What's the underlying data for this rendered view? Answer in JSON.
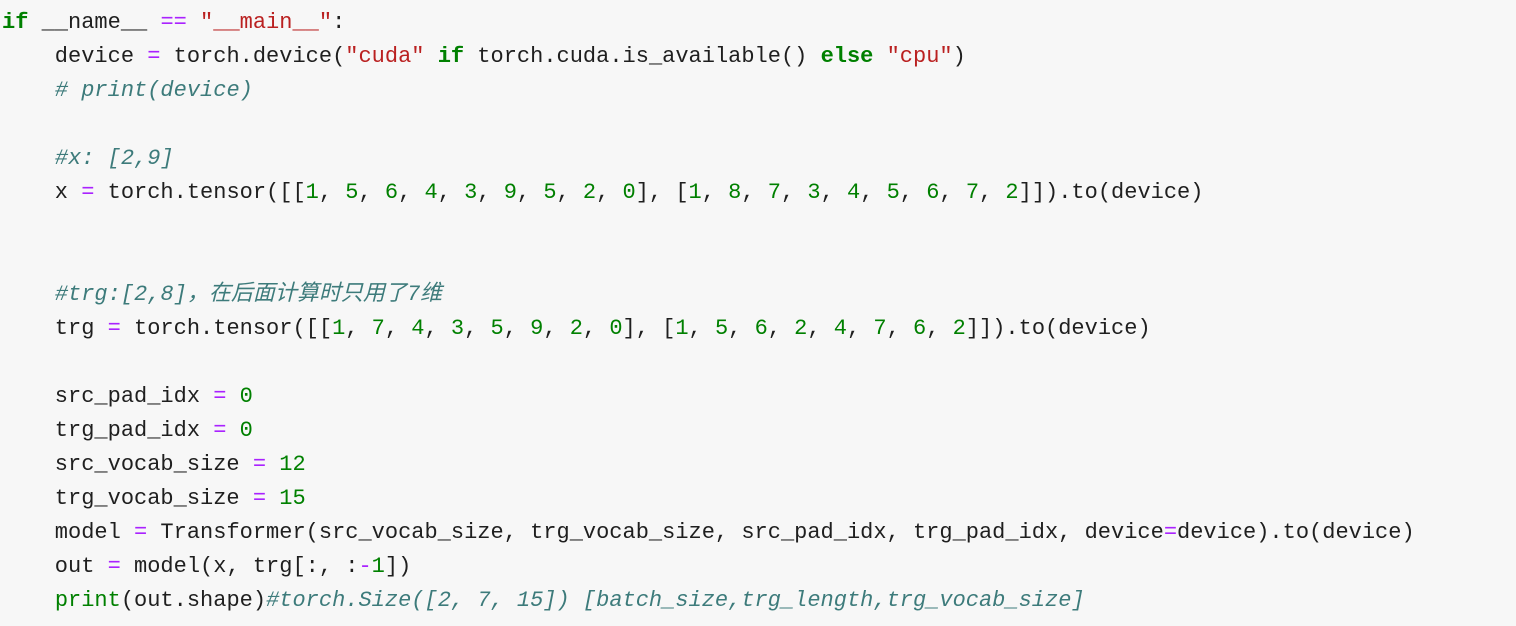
{
  "editor": {
    "lines": [
      [
        {
          "t": "if",
          "c": "kw"
        },
        {
          "t": " __name__ ",
          "c": "plain"
        },
        {
          "t": "==",
          "c": "op"
        },
        {
          "t": " ",
          "c": "plain"
        },
        {
          "t": "\"__main__\"",
          "c": "str"
        },
        {
          "t": ":",
          "c": "plain"
        }
      ],
      [
        {
          "t": "    device ",
          "c": "plain"
        },
        {
          "t": "=",
          "c": "op"
        },
        {
          "t": " torch.device(",
          "c": "plain"
        },
        {
          "t": "\"cuda\"",
          "c": "str"
        },
        {
          "t": " ",
          "c": "plain"
        },
        {
          "t": "if",
          "c": "kw"
        },
        {
          "t": " torch.cuda.is_available() ",
          "c": "plain"
        },
        {
          "t": "else",
          "c": "kw"
        },
        {
          "t": " ",
          "c": "plain"
        },
        {
          "t": "\"cpu\"",
          "c": "str"
        },
        {
          "t": ")",
          "c": "plain"
        }
      ],
      [
        {
          "t": "    ",
          "c": "plain"
        },
        {
          "t": "# print(device)",
          "c": "com"
        }
      ],
      [],
      [
        {
          "t": "    ",
          "c": "plain"
        },
        {
          "t": "#x: [2,9]",
          "c": "com"
        }
      ],
      [
        {
          "t": "    x ",
          "c": "plain"
        },
        {
          "t": "=",
          "c": "op"
        },
        {
          "t": " torch.tensor([[",
          "c": "plain"
        },
        {
          "t": "1",
          "c": "num"
        },
        {
          "t": ", ",
          "c": "plain"
        },
        {
          "t": "5",
          "c": "num"
        },
        {
          "t": ", ",
          "c": "plain"
        },
        {
          "t": "6",
          "c": "num"
        },
        {
          "t": ", ",
          "c": "plain"
        },
        {
          "t": "4",
          "c": "num"
        },
        {
          "t": ", ",
          "c": "plain"
        },
        {
          "t": "3",
          "c": "num"
        },
        {
          "t": ", ",
          "c": "plain"
        },
        {
          "t": "9",
          "c": "num"
        },
        {
          "t": ", ",
          "c": "plain"
        },
        {
          "t": "5",
          "c": "num"
        },
        {
          "t": ", ",
          "c": "plain"
        },
        {
          "t": "2",
          "c": "num"
        },
        {
          "t": ", ",
          "c": "plain"
        },
        {
          "t": "0",
          "c": "num"
        },
        {
          "t": "], [",
          "c": "plain"
        },
        {
          "t": "1",
          "c": "num"
        },
        {
          "t": ", ",
          "c": "plain"
        },
        {
          "t": "8",
          "c": "num"
        },
        {
          "t": ", ",
          "c": "plain"
        },
        {
          "t": "7",
          "c": "num"
        },
        {
          "t": ", ",
          "c": "plain"
        },
        {
          "t": "3",
          "c": "num"
        },
        {
          "t": ", ",
          "c": "plain"
        },
        {
          "t": "4",
          "c": "num"
        },
        {
          "t": ", ",
          "c": "plain"
        },
        {
          "t": "5",
          "c": "num"
        },
        {
          "t": ", ",
          "c": "plain"
        },
        {
          "t": "6",
          "c": "num"
        },
        {
          "t": ", ",
          "c": "plain"
        },
        {
          "t": "7",
          "c": "num"
        },
        {
          "t": ", ",
          "c": "plain"
        },
        {
          "t": "2",
          "c": "num"
        },
        {
          "t": "]]).to(device)",
          "c": "plain"
        }
      ],
      [],
      [],
      [
        {
          "t": "    ",
          "c": "plain"
        },
        {
          "t": "#trg:[2,8]，在后面计算时只用了7维",
          "c": "com"
        }
      ],
      [
        {
          "t": "    trg ",
          "c": "plain"
        },
        {
          "t": "=",
          "c": "op"
        },
        {
          "t": " torch.tensor([[",
          "c": "plain"
        },
        {
          "t": "1",
          "c": "num"
        },
        {
          "t": ", ",
          "c": "plain"
        },
        {
          "t": "7",
          "c": "num"
        },
        {
          "t": ", ",
          "c": "plain"
        },
        {
          "t": "4",
          "c": "num"
        },
        {
          "t": ", ",
          "c": "plain"
        },
        {
          "t": "3",
          "c": "num"
        },
        {
          "t": ", ",
          "c": "plain"
        },
        {
          "t": "5",
          "c": "num"
        },
        {
          "t": ", ",
          "c": "plain"
        },
        {
          "t": "9",
          "c": "num"
        },
        {
          "t": ", ",
          "c": "plain"
        },
        {
          "t": "2",
          "c": "num"
        },
        {
          "t": ", ",
          "c": "plain"
        },
        {
          "t": "0",
          "c": "num"
        },
        {
          "t": "], [",
          "c": "plain"
        },
        {
          "t": "1",
          "c": "num"
        },
        {
          "t": ", ",
          "c": "plain"
        },
        {
          "t": "5",
          "c": "num"
        },
        {
          "t": ", ",
          "c": "plain"
        },
        {
          "t": "6",
          "c": "num"
        },
        {
          "t": ", ",
          "c": "plain"
        },
        {
          "t": "2",
          "c": "num"
        },
        {
          "t": ", ",
          "c": "plain"
        },
        {
          "t": "4",
          "c": "num"
        },
        {
          "t": ", ",
          "c": "plain"
        },
        {
          "t": "7",
          "c": "num"
        },
        {
          "t": ", ",
          "c": "plain"
        },
        {
          "t": "6",
          "c": "num"
        },
        {
          "t": ", ",
          "c": "plain"
        },
        {
          "t": "2",
          "c": "num"
        },
        {
          "t": "]]).to(device)",
          "c": "plain"
        }
      ],
      [],
      [
        {
          "t": "    src_pad_idx ",
          "c": "plain"
        },
        {
          "t": "=",
          "c": "op"
        },
        {
          "t": " ",
          "c": "plain"
        },
        {
          "t": "0",
          "c": "num"
        }
      ],
      [
        {
          "t": "    trg_pad_idx ",
          "c": "plain"
        },
        {
          "t": "=",
          "c": "op"
        },
        {
          "t": " ",
          "c": "plain"
        },
        {
          "t": "0",
          "c": "num"
        }
      ],
      [
        {
          "t": "    src_vocab_size ",
          "c": "plain"
        },
        {
          "t": "=",
          "c": "op"
        },
        {
          "t": " ",
          "c": "plain"
        },
        {
          "t": "12",
          "c": "num"
        }
      ],
      [
        {
          "t": "    trg_vocab_size ",
          "c": "plain"
        },
        {
          "t": "=",
          "c": "op"
        },
        {
          "t": " ",
          "c": "plain"
        },
        {
          "t": "15",
          "c": "num"
        }
      ],
      [
        {
          "t": "    model ",
          "c": "plain"
        },
        {
          "t": "=",
          "c": "op"
        },
        {
          "t": " Transformer(src_vocab_size, trg_vocab_size, src_pad_idx, trg_pad_idx, device",
          "c": "plain"
        },
        {
          "t": "=",
          "c": "op"
        },
        {
          "t": "device).to(device)",
          "c": "plain"
        }
      ],
      [
        {
          "t": "    out ",
          "c": "plain"
        },
        {
          "t": "=",
          "c": "op"
        },
        {
          "t": " model(x, trg[:, :",
          "c": "plain"
        },
        {
          "t": "-",
          "c": "op"
        },
        {
          "t": "1",
          "c": "num"
        },
        {
          "t": "])",
          "c": "plain"
        }
      ],
      [
        {
          "t": "    ",
          "c": "plain"
        },
        {
          "t": "print",
          "c": "builtin"
        },
        {
          "t": "(out.shape)",
          "c": "plain"
        },
        {
          "t": "#torch.Size([2, 7, 15]) [batch_size,trg_length,trg_vocab_size]",
          "c": "com"
        }
      ]
    ]
  }
}
